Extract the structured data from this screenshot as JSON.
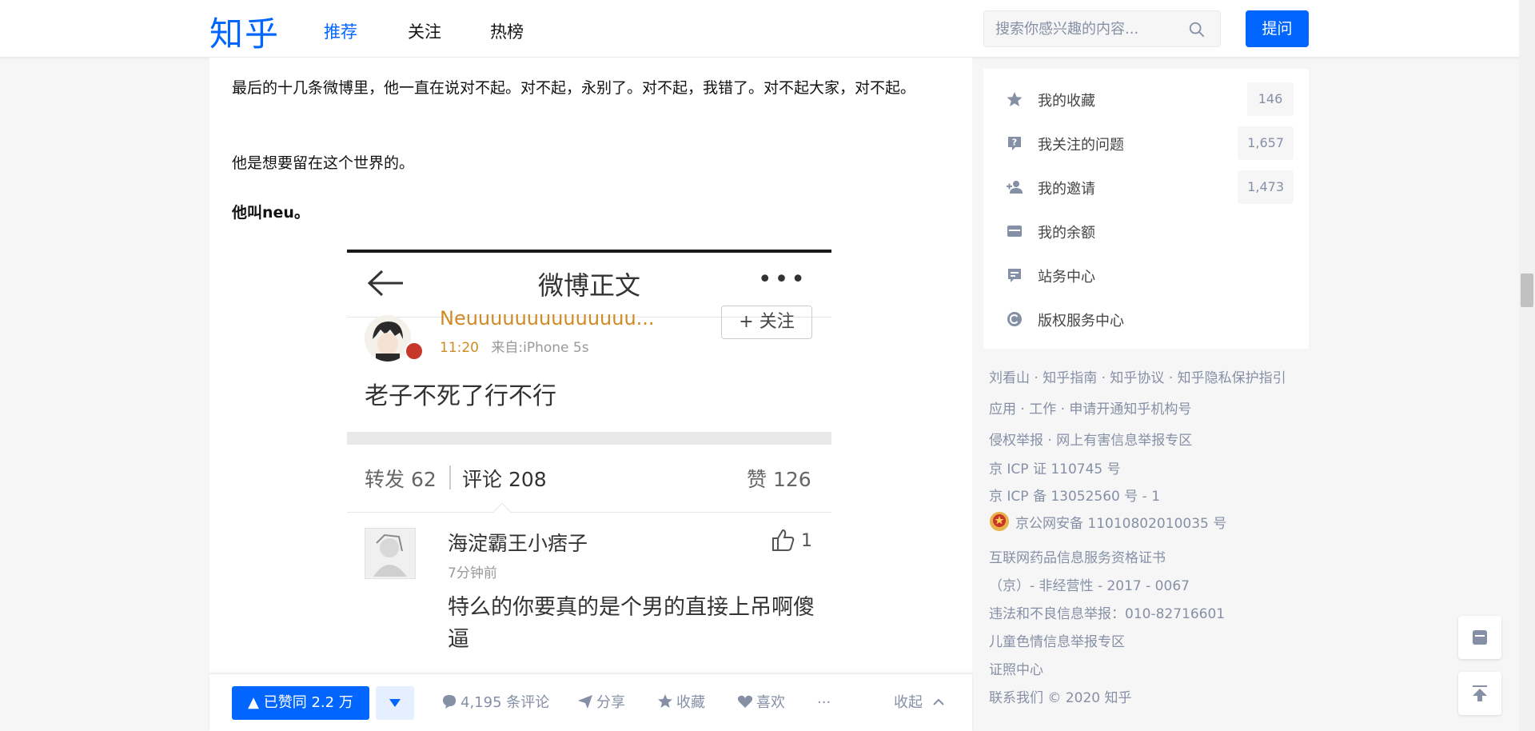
{
  "header": {
    "logo": "知乎",
    "tabs": [
      {
        "label": "推荐",
        "active": true
      },
      {
        "label": "关注",
        "active": false
      },
      {
        "label": "热榜",
        "active": false
      }
    ],
    "search_placeholder": "搜索你感兴趣的内容...",
    "ask_label": "提问"
  },
  "article": {
    "paragraphs": [
      "最后的十几条微博里，他一直在说对不起。对不起，永别了。对不起，我错了。对不起大家，对不起。",
      "他是想要留在这个世界的。",
      "他叫neu。"
    ],
    "screenshot": {
      "title": "微博正文",
      "more": "•••",
      "username": "Neuuuuuuuuuuuuuu...",
      "time": "11:20",
      "source": "来自:iPhone 5s",
      "follow_label": "+ 关注",
      "post_text": "老子不死了行不行",
      "repost": "转发 62",
      "comment": "评论 208",
      "like": "赞 126",
      "commenter": "海淀霸王小痞子",
      "comment_time": "7分钟前",
      "comment_likes": "1",
      "comment_text": "特么的你要真的是个男的直接上吊啊傻逼"
    }
  },
  "actions": {
    "upvote": "▲ 已赞同 2.2 万",
    "comments": "4,195 条评论",
    "share": "分享",
    "collect": "收藏",
    "like": "喜欢",
    "more": "···",
    "collapse": "收起"
  },
  "sidebar": {
    "items": [
      {
        "label": "我的收藏",
        "count": "146",
        "icon": "star-icon"
      },
      {
        "label": "我关注的问题",
        "count": "1,657",
        "icon": "question-icon"
      },
      {
        "label": "我的邀请",
        "count": "1,473",
        "icon": "invite-icon"
      },
      {
        "label": "我的余额",
        "count": "",
        "icon": "wallet-icon"
      },
      {
        "label": "站务中心",
        "count": "",
        "icon": "message-icon"
      },
      {
        "label": "版权服务中心",
        "count": "",
        "icon": "copyright-icon"
      }
    ]
  },
  "footer": {
    "lines": [
      "刘看山 · 知乎指南 · 知乎协议 · 知乎隐私保护指引",
      "应用 · 工作 · 申请开通知乎机构号",
      "侵权举报 · 网上有害信息举报专区",
      "京 ICP 证 110745 号",
      "京 ICP 备 13052560 号 - 1",
      "京公网安备 11010802010035 号",
      "互联网药品信息服务资格证书",
      "（京）- 非经营性 - 2017 - 0067",
      "违法和不良信息举报：010-82716601",
      "儿童色情信息举报专区",
      "证照中心",
      "联系我们 © 2020 知乎"
    ]
  },
  "colors": {
    "brand": "#0066ff",
    "muted": "#8590a6"
  }
}
